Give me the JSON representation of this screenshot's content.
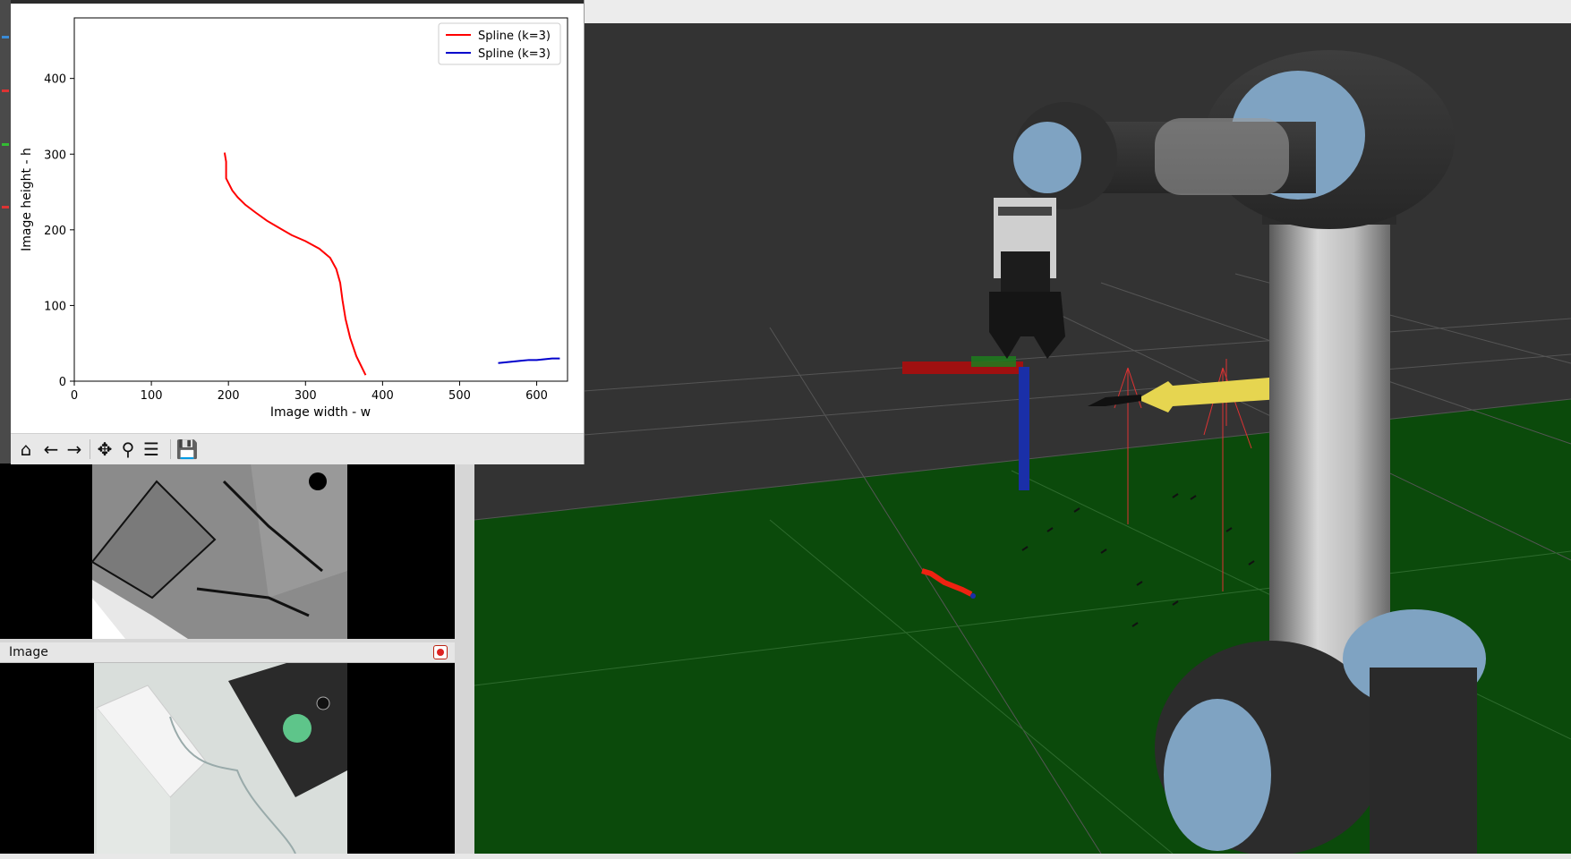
{
  "plot_window": {
    "toolbar": [
      {
        "name": "home-icon",
        "glyph": "⌂"
      },
      {
        "name": "back-icon",
        "glyph": "←"
      },
      {
        "name": "forward-icon",
        "glyph": "→"
      },
      {
        "name": "pan-icon",
        "glyph": "✥"
      },
      {
        "name": "zoom-icon",
        "glyph": "⚲"
      },
      {
        "name": "configure-icon",
        "glyph": "☰"
      },
      {
        "name": "save-icon",
        "glyph": "💾"
      }
    ]
  },
  "chart_data": {
    "type": "line",
    "xlabel": "Image width  - w",
    "ylabel": "Image height - h",
    "xlim": [
      0,
      640
    ],
    "ylim": [
      0,
      480
    ],
    "xticks": [
      0,
      100,
      200,
      300,
      400,
      500,
      600
    ],
    "yticks": [
      0,
      100,
      200,
      300,
      400
    ],
    "grid": false,
    "legend": "top-right",
    "series": [
      {
        "name": "Spline (k=3)",
        "color": "#ff0000",
        "x": [
          195,
          197,
          197,
          200,
          205,
          212,
          222,
          235,
          250,
          265,
          282,
          300,
          318,
          332,
          340,
          345,
          348,
          352,
          358,
          366,
          378
        ],
        "y": [
          302,
          290,
          268,
          262,
          252,
          243,
          233,
          223,
          212,
          203,
          193,
          185,
          175,
          163,
          148,
          130,
          107,
          82,
          57,
          33,
          8
        ]
      },
      {
        "name": "Spline (k=3)",
        "color": "#0000cc",
        "x": [
          550,
          560,
          570,
          580,
          590,
          600,
          610,
          620,
          630
        ],
        "y": [
          24,
          25,
          26,
          27,
          28,
          28,
          29,
          30,
          30
        ]
      }
    ]
  },
  "image_panel": {
    "title": "Image"
  },
  "view3d": {
    "floor_color": "#0b4a0b",
    "background_color": "#333333",
    "robot_cap_color": "#7fa3c2"
  }
}
